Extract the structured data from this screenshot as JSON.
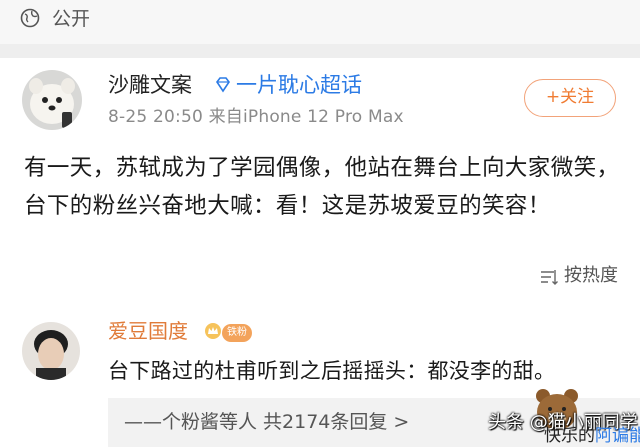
{
  "visibility": {
    "icon": "globe-icon",
    "label": "公开"
  },
  "post": {
    "author": "沙雕文案",
    "badge_icon": "diamond-icon",
    "supertopic": "一片耽心超话",
    "meta": "8-25 20:50  来自iPhone 12 Pro Max",
    "follow_label": "+关注",
    "text": "有一天，苏轼成为了学园偶像，他站在舞台上向大家微笑，台下的粉丝兴奋地大喊：看！这是苏坡爱豆的笑容！"
  },
  "sort": {
    "icon": "sort-icon",
    "label": "按热度"
  },
  "comment": {
    "author": "爱豆国度",
    "badge": "铁粉",
    "text": "台下路过的杜甫听到之后摇摇头：都没李的甜。",
    "replies_label": "——个粉酱等人  共2174条回复 >"
  },
  "watermark": {
    "line1": "头条 @猫小丽同学",
    "line2_prefix": "快乐的",
    "line2_highlight": "阿谝能"
  },
  "colors": {
    "accent": "#f07c33",
    "link": "#2c7be5",
    "commenter": "#e07b39"
  }
}
